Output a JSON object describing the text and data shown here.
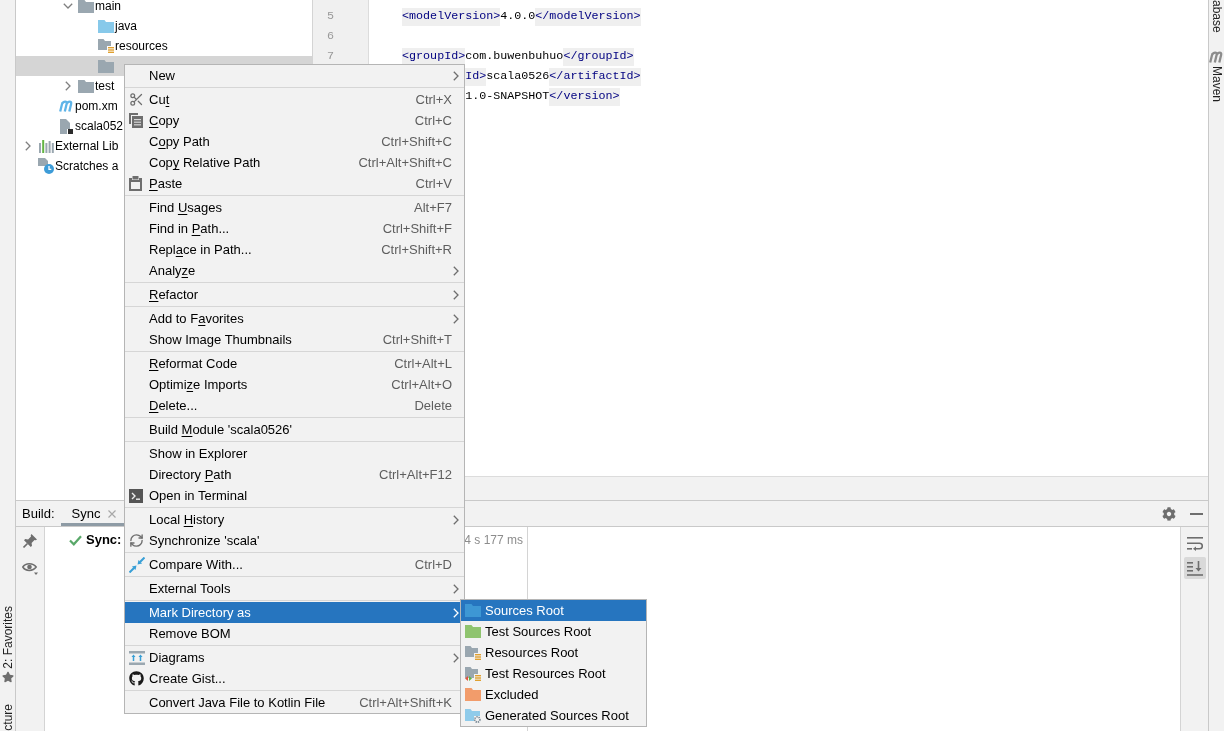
{
  "left_strip": [
    {
      "kind": "starred",
      "label": "2: Favorites"
    },
    {
      "kind": "plain",
      "label": "cture"
    }
  ],
  "project_tree": {
    "items": [
      {
        "children": [
          {
            "children": [
              {
                "label": "main",
                "kind": "folder",
                "expanded": true,
                "selected": false,
                "children": [
                  {
                    "label": "java",
                    "kind": "source-folder",
                    "selected": false
                  },
                  {
                    "label": "resources",
                    "kind": "resources-folder",
                    "selected": false
                  },
                  {
                    "kind": "folder",
                    "selected": true
                  }
                ]
              },
              {
                "label": "test",
                "kind": "folder",
                "expanded": false,
                "selected": false
              }
            ]
          },
          {
            "label": "pom.xm",
            "kind": "maven-file",
            "selected": false
          },
          {
            "label": "scala052",
            "kind": "module-file",
            "selected": false
          }
        ]
      },
      {
        "label": "External Lib",
        "kind": "libraries",
        "expanded": false,
        "selected": false
      },
      {
        "label": "Scratches a",
        "kind": "scratches",
        "selected": false
      }
    ]
  },
  "editor": {
    "lines": [
      {
        "number": "5",
        "tokens": [
          {
            "kind": "tag",
            "text": "    <modelVersion>"
          },
          {
            "kind": "text",
            "text": "4.0.0"
          },
          {
            "kind": "tag",
            "text": "</modelVersion>"
          }
        ]
      },
      {
        "number": "6"
      },
      {
        "number": "7",
        "tokens": [
          {
            "kind": "tag",
            "text": "    <groupId>"
          },
          {
            "kind": "text",
            "text": "com.buwenbuhuo"
          },
          {
            "kind": "tag",
            "text": "</groupId>"
          }
        ]
      },
      {
        "tokens": [
          {
            "kind": "tag",
            "text": "             Id>"
          },
          {
            "kind": "text",
            "text": "scala0526"
          },
          {
            "kind": "tag",
            "text": "</artifactId>"
          }
        ]
      },
      {
        "tokens": [
          {
            "kind": "text",
            "text": "             1.0-SNAPSHOT"
          },
          {
            "kind": "tag",
            "text": "</version>"
          }
        ]
      }
    ]
  },
  "build": {
    "title": "Build:",
    "tabs": [
      {
        "label": "Sync",
        "selected": true
      }
    ],
    "tasks": [
      {
        "succeeded": true,
        "label": "Sync:",
        "duration": "4 s 177 ms"
      }
    ],
    "side_tools": [
      {
        "kind": "soft-wrap",
        "on": false
      },
      {
        "kind": "scroll-to-end",
        "on": true
      }
    ]
  },
  "right_strip": [
    {
      "kind": "plain",
      "label": "abase"
    },
    {
      "kind": "maven",
      "label": "Maven"
    }
  ],
  "context_menu": {
    "groups": [
      [
        {
          "kind": "plain",
          "label": [
            {
              "text": "New",
              "underline": false
            }
          ],
          "submenu": true,
          "selected": false
        }
      ],
      [
        {
          "kind": "scissors",
          "label": [
            {
              "text": "Cu",
              "underline": false
            },
            {
              "text": "t",
              "underline": true
            }
          ],
          "shortcut": "Ctrl+X",
          "submenu": false,
          "selected": false
        },
        {
          "kind": "copy",
          "label": [
            {
              "text": "C",
              "underline": true
            },
            {
              "text": "opy",
              "underline": false
            }
          ],
          "shortcut": "Ctrl+C",
          "submenu": false,
          "selected": false
        },
        {
          "kind": "plain",
          "label": [
            {
              "text": "C",
              "underline": false
            },
            {
              "text": "o",
              "underline": true
            },
            {
              "text": "py Path",
              "underline": false
            }
          ],
          "shortcut": "Ctrl+Shift+C",
          "submenu": false,
          "selected": false
        },
        {
          "kind": "plain",
          "label": [
            {
              "text": "Cop",
              "underline": false
            },
            {
              "text": "y",
              "underline": true
            },
            {
              "text": " Relative Path",
              "underline": false
            }
          ],
          "shortcut": "Ctrl+Alt+Shift+C",
          "submenu": false,
          "selected": false
        },
        {
          "kind": "paste",
          "label": [
            {
              "text": "P",
              "underline": true
            },
            {
              "text": "aste",
              "underline": false
            }
          ],
          "shortcut": "Ctrl+V",
          "submenu": false,
          "selected": false
        }
      ],
      [
        {
          "kind": "plain",
          "label": [
            {
              "text": "Find ",
              "underline": false
            },
            {
              "text": "U",
              "underline": true
            },
            {
              "text": "sages",
              "underline": false
            }
          ],
          "shortcut": "Alt+F7",
          "submenu": false,
          "selected": false
        },
        {
          "kind": "plain",
          "label": [
            {
              "text": "Find in ",
              "underline": false
            },
            {
              "text": "P",
              "underline": true
            },
            {
              "text": "ath...",
              "underline": false
            }
          ],
          "shortcut": "Ctrl+Shift+F",
          "submenu": false,
          "selected": false
        },
        {
          "kind": "plain",
          "label": [
            {
              "text": "Repl",
              "underline": false
            },
            {
              "text": "a",
              "underline": true
            },
            {
              "text": "ce in Path...",
              "underline": false
            }
          ],
          "shortcut": "Ctrl+Shift+R",
          "submenu": false,
          "selected": false
        },
        {
          "kind": "plain",
          "label": [
            {
              "text": "Analy",
              "underline": false
            },
            {
              "text": "z",
              "underline": true
            },
            {
              "text": "e",
              "underline": false
            }
          ],
          "submenu": true,
          "selected": false
        }
      ],
      [
        {
          "kind": "plain",
          "label": [
            {
              "text": "R",
              "underline": true
            },
            {
              "text": "efactor",
              "underline": false
            }
          ],
          "submenu": true,
          "selected": false
        }
      ],
      [
        {
          "kind": "plain",
          "label": [
            {
              "text": "Add to F",
              "underline": false
            },
            {
              "text": "a",
              "underline": true
            },
            {
              "text": "vorites",
              "underline": false
            }
          ],
          "submenu": true,
          "selected": false
        },
        {
          "kind": "plain",
          "label": [
            {
              "text": "Show Image Thumbnails",
              "underline": false
            }
          ],
          "shortcut": "Ctrl+Shift+T",
          "submenu": false,
          "selected": false
        }
      ],
      [
        {
          "kind": "plain",
          "label": [
            {
              "text": "R",
              "underline": true
            },
            {
              "text": "eformat Code",
              "underline": false
            }
          ],
          "shortcut": "Ctrl+Alt+L",
          "submenu": false,
          "selected": false
        },
        {
          "kind": "plain",
          "label": [
            {
              "text": "Optimi",
              "underline": false
            },
            {
              "text": "z",
              "underline": true
            },
            {
              "text": "e Imports",
              "underline": false
            }
          ],
          "shortcut": "Ctrl+Alt+O",
          "submenu": false,
          "selected": false
        },
        {
          "kind": "plain",
          "label": [
            {
              "text": "D",
              "underline": true
            },
            {
              "text": "elete...",
              "underline": false
            }
          ],
          "shortcut": "Delete",
          "submenu": false,
          "selected": false
        }
      ],
      [
        {
          "kind": "plain",
          "label": [
            {
              "text": "Build ",
              "underline": false
            },
            {
              "text": "M",
              "underline": true
            },
            {
              "text": "odule 'scala0526'",
              "underline": false
            }
          ],
          "submenu": false,
          "selected": false
        }
      ],
      [
        {
          "kind": "plain",
          "label": [
            {
              "text": "Show in Explorer",
              "underline": false
            }
          ],
          "submenu": false,
          "selected": false
        },
        {
          "kind": "plain",
          "label": [
            {
              "text": "Directory ",
              "underline": false
            },
            {
              "text": "P",
              "underline": true
            },
            {
              "text": "ath",
              "underline": false
            }
          ],
          "shortcut": "Ctrl+Alt+F12",
          "submenu": false,
          "selected": false
        },
        {
          "kind": "terminal",
          "label": [
            {
              "text": "Open in Terminal",
              "underline": false
            }
          ],
          "submenu": false,
          "selected": false
        }
      ],
      [
        {
          "kind": "plain",
          "label": [
            {
              "text": "Local ",
              "underline": false
            },
            {
              "text": "H",
              "underline": true
            },
            {
              "text": "istory",
              "underline": false
            }
          ],
          "submenu": true,
          "selected": false
        },
        {
          "kind": "sync",
          "label": [
            {
              "text": "Synchronize 'scala'",
              "underline": false
            }
          ],
          "submenu": false,
          "selected": false
        }
      ],
      [
        {
          "kind": "compare",
          "label": [
            {
              "text": "Compare With...",
              "underline": false
            }
          ],
          "shortcut": "Ctrl+D",
          "submenu": false,
          "selected": false
        }
      ],
      [
        {
          "kind": "plain",
          "label": [
            {
              "text": "External Tools",
              "underline": false
            }
          ],
          "submenu": true,
          "selected": false
        }
      ],
      [
        {
          "kind": "plain",
          "label": [
            {
              "text": "Mark Directory as",
              "underline": false
            }
          ],
          "submenu": true,
          "selected": true
        },
        {
          "kind": "plain",
          "label": [
            {
              "text": "Remove BOM",
              "underline": false
            }
          ],
          "submenu": false,
          "selected": false
        }
      ],
      [
        {
          "kind": "diagram",
          "label": [
            {
              "text": "Diagrams",
              "underline": false
            }
          ],
          "submenu": true,
          "selected": false
        },
        {
          "kind": "gist",
          "label": [
            {
              "text": "Create Gist...",
              "underline": false
            }
          ],
          "submenu": false,
          "selected": false
        }
      ],
      [
        {
          "kind": "plain",
          "label": [
            {
              "text": "Convert Java File to Kotlin File",
              "underline": false
            }
          ],
          "shortcut": "Ctrl+Alt+Shift+K",
          "submenu": false,
          "selected": false
        }
      ]
    ]
  },
  "submenu": {
    "items": [
      {
        "kind": "sources",
        "label": "Sources Root",
        "selected": true
      },
      {
        "kind": "test-sources",
        "label": "Test Sources Root",
        "selected": false
      },
      {
        "kind": "resources",
        "label": "Resources Root",
        "selected": false
      },
      {
        "kind": "test-resources",
        "label": "Test Resources Root",
        "selected": false
      },
      {
        "kind": "excluded",
        "label": "Excluded",
        "selected": false
      },
      {
        "kind": "generated",
        "label": "Generated Sources Root",
        "selected": false
      }
    ]
  }
}
